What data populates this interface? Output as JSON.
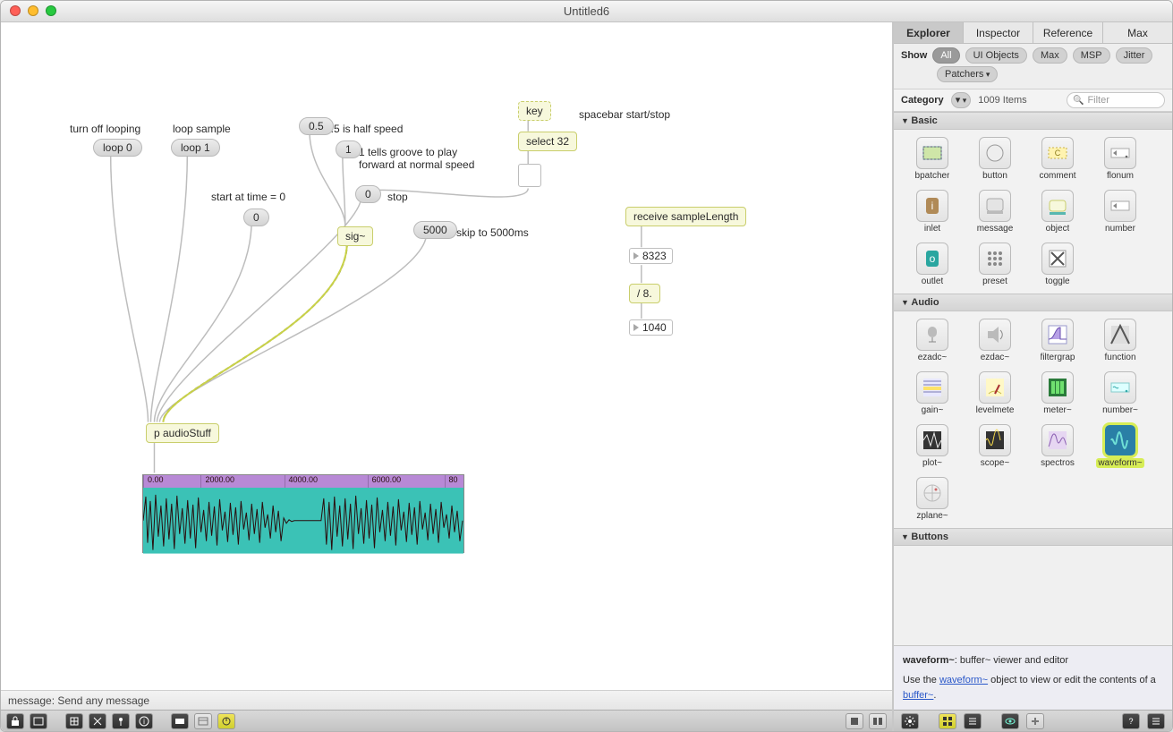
{
  "window": {
    "title": "Untitled6"
  },
  "patch": {
    "comments": {
      "loop_off": "turn off looping",
      "loop_on": "loop sample",
      "half_speed": "0.5 is half speed",
      "play_forward": "1 tells groove to play\nforward at normal speed",
      "start_zero": "start at time = 0",
      "stop": "stop",
      "skip": "skip to 5000ms",
      "spacebar": "spacebar start/stop"
    },
    "msgs": {
      "loop0": "loop 0",
      "loop1": "loop 1",
      "half": "0.5",
      "one": "1",
      "zero_a": "0",
      "zero_b": "0",
      "five_k": "5000"
    },
    "objs": {
      "key": "key",
      "select": "select 32",
      "sig": "sig~",
      "receive": "receive sampleLength",
      "div8": "/ 8.",
      "sub": "p audioStuff"
    },
    "nums": {
      "len": "8323",
      "out": "1040"
    },
    "waveform_ticks": [
      "0.00",
      "2000.00",
      "4000.00",
      "6000.00",
      "80"
    ]
  },
  "status": "message: Send any message",
  "sidebar": {
    "tabs": [
      "Explorer",
      "Inspector",
      "Reference",
      "Max"
    ],
    "active_tab": 0,
    "show_label": "Show",
    "show_pills": [
      "All",
      "UI Objects",
      "Max",
      "MSP",
      "Jitter"
    ],
    "patchers_pill": "Patchers",
    "category_label": "Category",
    "item_count": "1009 Items",
    "search_placeholder": "Filter",
    "sections": {
      "basic": {
        "title": "Basic",
        "items": [
          "bpatcher",
          "button",
          "comment",
          "flonum",
          "inlet",
          "message",
          "object",
          "number",
          "outlet",
          "preset",
          "toggle"
        ]
      },
      "audio": {
        "title": "Audio",
        "items": [
          "ezadc~",
          "ezdac~",
          "filtergrap",
          "function",
          "gain~",
          "levelmete",
          "meter~",
          "number~",
          "plot~",
          "scope~",
          "spectros",
          "waveform~",
          "zplane~"
        ],
        "selected": "waveform~"
      },
      "buttons": {
        "title": "Buttons"
      }
    },
    "help": {
      "headline_obj": "waveform~",
      "headline_rest": ": buffer~ viewer and editor",
      "body_pre": "Use the ",
      "body_link1": "waveform~",
      "body_mid": " object to view or edit the contents of a ",
      "body_link2": "buffer~",
      "body_post": "."
    }
  }
}
